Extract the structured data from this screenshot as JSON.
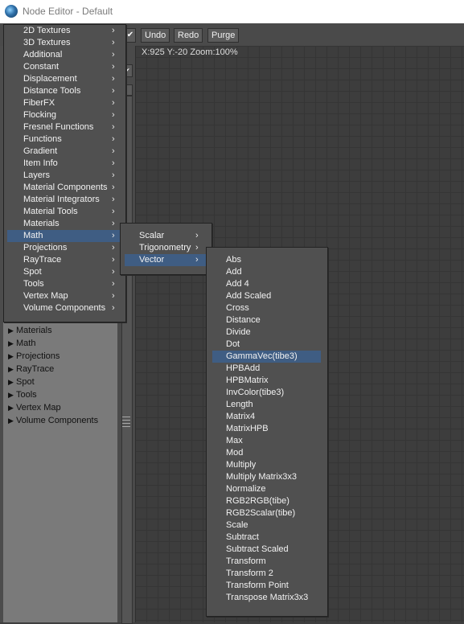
{
  "window": {
    "title": "Node Editor - Default"
  },
  "toolbar": {
    "undo_label": "Undo",
    "redo_label": "Redo",
    "purge_label": "Purge"
  },
  "status": {
    "text": "X:925 Y:-20 Zoom:100%"
  },
  "tree": {
    "items": [
      "Materials",
      "Math",
      "Projections",
      "RayTrace",
      "Spot",
      "Tools",
      "Vertex Map",
      "Volume Components"
    ]
  },
  "main_menu": {
    "items": [
      "2D Textures",
      "3D Textures",
      "Additional",
      "Constant",
      "Displacement",
      "Distance Tools",
      "FiberFX",
      "Flocking",
      "Fresnel Functions",
      "Functions",
      "Gradient",
      "Item Info",
      "Layers",
      "Material Components",
      "Material Integrators",
      "Material Tools",
      "Materials",
      "Math",
      "Projections",
      "RayTrace",
      "Spot",
      "Tools",
      "Vertex Map",
      "Volume Components"
    ],
    "highlighted": "Math"
  },
  "math_menu": {
    "items": [
      "Scalar",
      "Trigonometry",
      "Vector"
    ],
    "highlighted": "Vector"
  },
  "vector_menu": {
    "items": [
      "Abs",
      "Add",
      "Add 4",
      "Add Scaled",
      "Cross",
      "Distance",
      "Divide",
      "Dot",
      "GammaVec(tibe3)",
      "HPBAdd",
      "HPBMatrix",
      "InvColor(tibe3)",
      "Length",
      "Matrix4",
      "MatrixHPB",
      "Max",
      "Mod",
      "Multiply",
      "Multiply Matrix3x3",
      "Normalize",
      "RGB2RGB(tibe)",
      "RGB2Scalar(tibe)",
      "Scale",
      "Subtract",
      "Subtract Scaled",
      "Transform",
      "Transform 2",
      "Transform Point",
      "Transpose Matrix3x3"
    ],
    "highlighted": "GammaVec(tibe3)"
  },
  "colors": {
    "highlight": "#3f5d83",
    "menu_bg": "#505050",
    "canvas_bg": "#3d3d3d",
    "tree_bg": "#7a7a7a"
  },
  "icons": {
    "app": "lightwave-app-icon",
    "submenu": "chevron-right-icon",
    "tree_expand": "tree-arrow-icon",
    "check": "chevron-down-icon",
    "grip": "grip-icon"
  }
}
